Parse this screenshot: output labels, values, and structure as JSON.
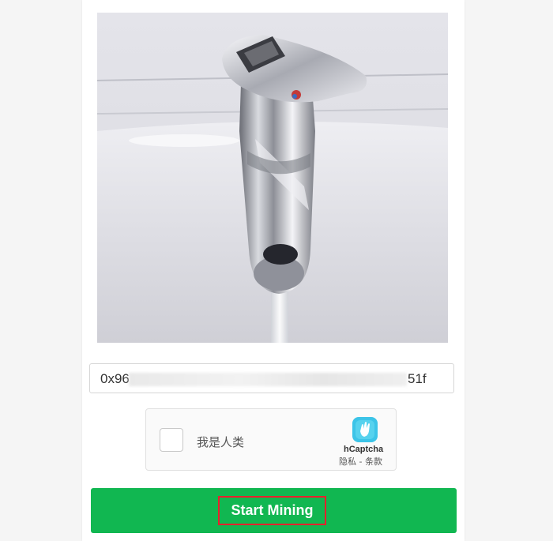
{
  "wallet": {
    "address_prefix": "0x96",
    "address_suffix": "51f"
  },
  "captcha": {
    "checkbox_label": "我是人类",
    "brand": "hCaptcha",
    "links": "隐私 - 条款"
  },
  "actions": {
    "start_label": "Start Mining"
  },
  "colors": {
    "button": "#11b751",
    "highlight": "#e8202d",
    "hcaptcha_logo": "#3cc4e8"
  }
}
